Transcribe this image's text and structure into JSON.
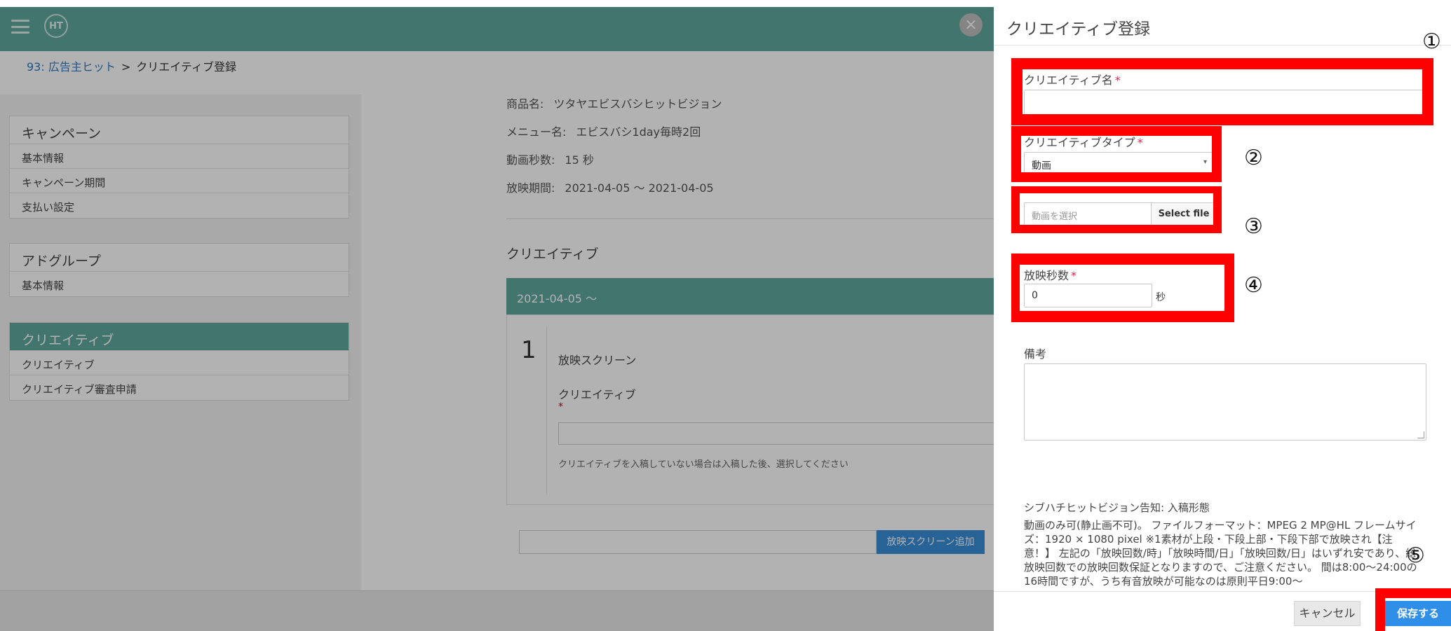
{
  "header": {
    "menu_icon": "hamburger-icon",
    "logo_text": "HT",
    "close_icon": "close-icon",
    "close_symbol": "×"
  },
  "breadcrumb": {
    "parent": "93: 広告主ヒット",
    "separator": ">",
    "current": "クリエイティブ登録"
  },
  "sidebar": {
    "groups": [
      {
        "title": "キャンペーン",
        "items": [
          "基本情報",
          "キャンペーン期間",
          "支払い設定"
        ]
      },
      {
        "title": "アドグループ",
        "items": [
          "基本情報"
        ]
      },
      {
        "title": "クリエイティブ",
        "items": [
          "クリエイティブ",
          "クリエイティブ審査申請"
        ]
      }
    ]
  },
  "main": {
    "info": [
      {
        "label": "商品名:",
        "value": "ツタヤエビスバシヒットビジョン"
      },
      {
        "label": "メニュー名:",
        "value": "エビスバシ1day毎時2回"
      },
      {
        "label": "動画秒数:",
        "value": "15 秒"
      },
      {
        "label": "放映期間:",
        "value": "2021-04-05 ～ 2021-04-05"
      }
    ],
    "creative_heading": "クリエイティブ",
    "schedule_label": "2021-04-05 ～",
    "screen_number": "1",
    "screen_label": "放映スクリーン",
    "creative_label": "クリエイティブ",
    "required_mark": "*",
    "creative_help": "クリエイティブを入稿していない場合は入稿した後、選択してください",
    "add_screen_button": "放映スクリーン追加"
  },
  "drawer": {
    "title": "クリエイティブ登録",
    "name_label": "クリエイティブ名",
    "name_value": "",
    "required_mark": "*",
    "type_label": "クリエイティブタイプ",
    "type_value": "動画",
    "file_placeholder": "動画を選択",
    "select_file_button": "Select file",
    "seconds_label": "放映秒数",
    "seconds_value": "0",
    "seconds_unit": "秒",
    "notes_label": "備考",
    "notice_title": "シブハチヒットビジョン告知: 入稿形態",
    "notice_body": "動画のみ可(静止画不可)。 ファイルフォーマット：MPEG 2 MP@HL フレームサイズ：1920 × 1080 pixel ※1素材が上段・下段上部・下段下部で放映され【注意！】 左記の「放映回数/時」「放映時間/日」「放映回数/日」はいずれ安であり、総放映回数での放映回数保証となりますので、ご注意ください。 間は8:00～24:00の16時間ですが、うち有音放映が可能なのは原則平日9:00～",
    "cancel_button": "キャンセル",
    "save_button": "保存する"
  },
  "annotations": {
    "markers": [
      "①",
      "②",
      "③",
      "④",
      "⑤"
    ],
    "box_color": "#ff0000"
  },
  "colors": {
    "header": "#5fa89e",
    "primary_button": "#2f8ee8",
    "link": "#2a7ac9"
  }
}
